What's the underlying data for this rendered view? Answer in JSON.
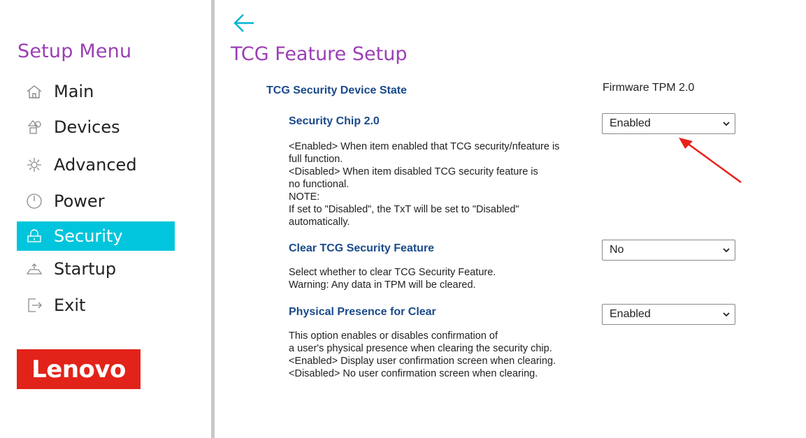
{
  "sidebar": {
    "title": "Setup Menu",
    "items": [
      {
        "label": "Main",
        "icon": "home-icon"
      },
      {
        "label": "Devices",
        "icon": "devices-icon"
      },
      {
        "label": "Advanced",
        "icon": "advanced-icon"
      },
      {
        "label": "Power",
        "icon": "power-icon"
      },
      {
        "label": "Security",
        "icon": "lock-icon",
        "active": true
      },
      {
        "label": "Startup",
        "icon": "startup-icon"
      },
      {
        "label": "Exit",
        "icon": "exit-icon"
      }
    ],
    "logo": "Lenovo"
  },
  "header": {
    "back_icon": "back-arrow-icon",
    "title": "TCG Feature Setup"
  },
  "settings": {
    "device_state": {
      "label": "TCG Security Device State",
      "value": "Firmware TPM 2.0"
    },
    "security_chip": {
      "label": "Security Chip 2.0",
      "value": "Enabled",
      "description": [
        "<Enabled> When item enabled that TCG security/nfeature is",
        "full function.",
        "<Disabled> When item disabled TCG security feature is",
        "no functional.",
        "NOTE:",
        "If set to \"Disabled\", the TxT will be set to \"Disabled\"",
        "automatically."
      ]
    },
    "clear_tcg": {
      "label": "Clear TCG Security Feature",
      "value": "No",
      "description": [
        "Select whether to clear TCG Security Feature.",
        "Warning: Any data in TPM will be cleared."
      ]
    },
    "physical_presence": {
      "label": "Physical Presence for Clear",
      "value": "Enabled",
      "description": [
        "This option enables or disables confirmation of",
        "a user's physical presence when clearing the security chip.",
        "<Enabled> Display user confirmation screen when clearing.",
        "<Disabled> No user confirmation screen when clearing."
      ]
    }
  },
  "colors": {
    "accent": "#9b3fb5",
    "active": "#00c5dc",
    "label": "#1a4a8a",
    "logo": "#e2231a",
    "annotation": "#e8201a"
  }
}
